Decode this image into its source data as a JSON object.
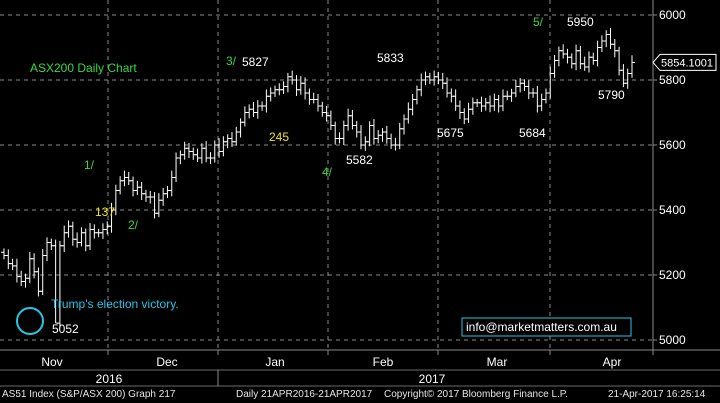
{
  "colors": {
    "background": "#000000",
    "grid": "#8a8a8a",
    "bars": "#ffffff",
    "green": "#39d846",
    "yellow": "#f2e21b",
    "cyan": "#26c6e6",
    "white": "#ffffff",
    "last_price_box": "#ffffff"
  },
  "chart_data": {
    "type": "ohlc",
    "title": "ASX200 Daily Chart",
    "y_axis": {
      "ticks": [
        5000,
        5200,
        5400,
        5600,
        5800,
        6000
      ],
      "ylim": [
        4985,
        6045
      ],
      "side": "right"
    },
    "x_axis": {
      "months": [
        "Nov",
        "Dec",
        "Jan",
        "Feb",
        "Mar",
        "Apr"
      ],
      "years": [
        "2016",
        "2017"
      ]
    },
    "last_price_label": "5854.1001",
    "last_price": 5854.1,
    "annotations": {
      "wave_labels": [
        "1/",
        "2/",
        "3/",
        "4/",
        "5/"
      ],
      "point_counts": [
        "137",
        "245"
      ],
      "price_levels": [
        "5052",
        "5827",
        "5582",
        "5833",
        "5675",
        "5684",
        "5950",
        "5790"
      ],
      "event_text": "Trump's election victory."
    },
    "series": [
      {
        "values": [
          5260,
          5235,
          5228,
          5195,
          5180,
          5190,
          5250,
          5210,
          5150,
          5260,
          5300,
          5290,
          5052,
          5290,
          5330,
          5350,
          5310,
          5300,
          5330,
          5290,
          5340,
          5330,
          5330,
          5340,
          5350,
          5400,
          5460,
          5490,
          5500,
          5490,
          5460,
          5470,
          5450,
          5440,
          5440,
          5390,
          5430,
          5450,
          5460,
          5500,
          5560,
          5570,
          5590,
          5580,
          5570,
          5560,
          5590,
          5560,
          5560,
          5600,
          5580,
          5610,
          5620,
          5610,
          5640,
          5670,
          5700,
          5710,
          5700,
          5720,
          5720,
          5750,
          5760,
          5770,
          5770,
          5780,
          5810,
          5800,
          5770,
          5790,
          5760,
          5740,
          5740,
          5720,
          5700,
          5690,
          5660,
          5620,
          5620,
          5660,
          5690,
          5660,
          5640,
          5600,
          5610,
          5660,
          5620,
          5630,
          5640,
          5620,
          5600,
          5600,
          5650,
          5680,
          5710,
          5740,
          5770,
          5800,
          5810,
          5800,
          5810,
          5800,
          5790,
          5760,
          5750,
          5720,
          5700,
          5680,
          5710,
          5730,
          5730,
          5720,
          5730,
          5720,
          5740,
          5720,
          5750,
          5750,
          5760,
          5780,
          5790,
          5780,
          5760,
          5760,
          5720,
          5740,
          5760,
          5820,
          5860,
          5890,
          5880,
          5870,
          5850,
          5890,
          5850,
          5840,
          5870,
          5860,
          5900,
          5920,
          5940,
          5910,
          5890,
          5830,
          5790,
          5820,
          5854.1
        ]
      }
    ]
  },
  "site_link": "info@marketmatters.com.au",
  "footer": {
    "security": "AS51 Index (S&P/ASX 200) Graph 217",
    "period": "Daily 21APR2016-21APR2017",
    "copyright": "Copyright© 2017 Bloomberg Finance L.P.",
    "timestamp": "21-Apr-2017 16:25:14"
  }
}
